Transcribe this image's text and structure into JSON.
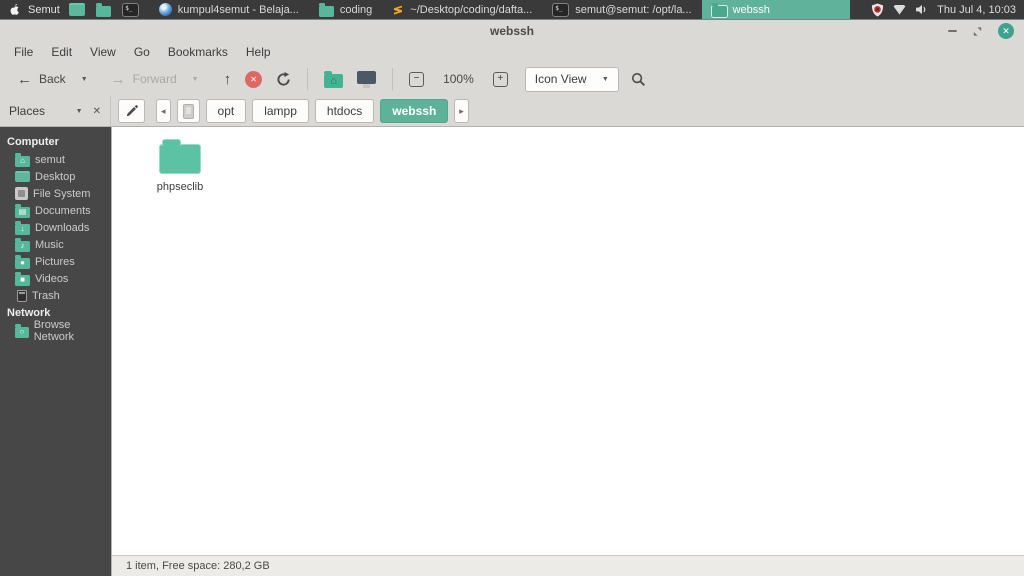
{
  "colors": {
    "accent_teal": "#5FB29A",
    "folder_teal": "#5CC2A4",
    "panel_bg": "#3A3A3A",
    "sidebar_bg": "#474747",
    "header_bg": "#DBD9D5",
    "close_button": "#3DA28F",
    "stop_button": "#DD6965"
  },
  "glyphs": {
    "back": "←",
    "forward": "→",
    "up": "↑",
    "caret_down": "▼",
    "scroll_left": "◂",
    "scroll_right": "▸",
    "close": "✕",
    "minus": "−",
    "plus": "+",
    "house": "⌂",
    "down": "↓",
    "note": "♪",
    "dot": "●",
    "square": "■",
    "circle": "○",
    "page": "▤",
    "prompt": "$_"
  },
  "panel": {
    "apple_menu_label": "Semut",
    "tasks": [
      {
        "label": "kumpul4semut - Belaja...",
        "icon": "browser"
      },
      {
        "label": "coding",
        "icon": "folder"
      },
      {
        "label": "~/Desktop/coding/dafta...",
        "icon": "sublime-text"
      },
      {
        "label": "semut@semut: /opt/la...",
        "icon": "terminal"
      },
      {
        "label": "webssh",
        "icon": "folder"
      }
    ],
    "clock": "Thu Jul 4, 10:03"
  },
  "window": {
    "title": "webssh",
    "menu": [
      "File",
      "Edit",
      "View",
      "Go",
      "Bookmarks",
      "Help"
    ],
    "toolbar": {
      "back_label": "Back",
      "forward_label": "Forward",
      "zoom_level": "100%",
      "view_mode": "Icon View"
    },
    "places_label": "Places",
    "breadcrumbs": [
      "opt",
      "lampp",
      "htdocs",
      "webssh"
    ],
    "sidebar": {
      "sections": [
        {
          "header": "Computer",
          "items": [
            {
              "label": "semut"
            },
            {
              "label": "Desktop"
            },
            {
              "label": "File System"
            },
            {
              "label": "Documents"
            },
            {
              "label": "Downloads"
            },
            {
              "label": "Music"
            },
            {
              "label": "Pictures"
            },
            {
              "label": "Videos"
            },
            {
              "label": "Trash"
            }
          ]
        },
        {
          "header": "Network",
          "items": [
            {
              "label": "Browse Network"
            }
          ]
        }
      ]
    },
    "files": [
      {
        "name": "phpseclib",
        "type": "folder"
      }
    ],
    "status_text": "1 item, Free space: 280,2 GB"
  }
}
